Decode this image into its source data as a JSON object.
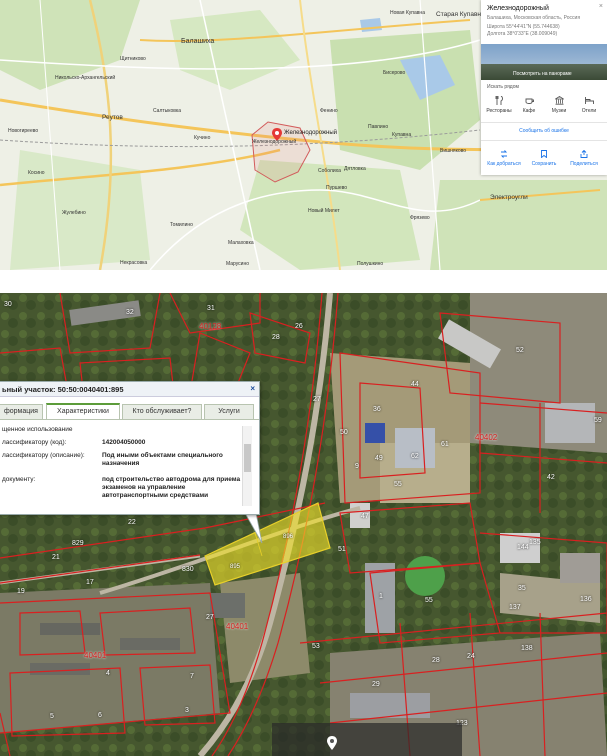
{
  "top_map": {
    "city_labels": [
      {
        "name": "city-balashikha",
        "text": "Балашиха"
      },
      {
        "name": "city-reutov",
        "text": "Реутов"
      },
      {
        "name": "city-zheleznodorozhny-marker",
        "text": "Железнодорожный"
      },
      {
        "name": "city-zheleznodorozhny-sub",
        "text": "Железнодорожный"
      },
      {
        "name": "city-staraya-kupavna",
        "text": "Старая Купавна"
      },
      {
        "name": "city-elektrougli",
        "text": "Электроугли"
      }
    ],
    "small_labels": [
      "Новая Купавна",
      "Щитниково",
      "Никольско-Архангельский",
      "Салтыковка",
      "Кучино",
      "Фенино",
      "Пуршево",
      "Соболиха",
      "Дятловка",
      "Новый Милет",
      "Малаховка",
      "Томилино",
      "Жулебино",
      "Некрасовка",
      "Косино",
      "Новогиреево",
      "Бисерово",
      "Павлино",
      "Купавна",
      "Фрязево",
      "Марусино",
      "Полушкино",
      "Вишняково"
    ],
    "info_panel": {
      "title": "Железнодорожный",
      "subtitle": "Балашиха, Московская область, Россия",
      "latitude_line": "Широта    55°44'41\"N (55.744638)",
      "longitude_line": "Долгота   38°0'33\"E (38.009049)",
      "photo_caption": "Посмотреть на панораме",
      "nearby_title": "Искать рядом",
      "nearby_items": [
        "Рестораны",
        "Кафе",
        "Музеи",
        "Отели"
      ],
      "report_link": "Сообщить об ошибке",
      "actions": [
        "Как добраться",
        "Сохранить",
        "Поделиться"
      ],
      "close_label": "×"
    }
  },
  "parcel_popup": {
    "title": "ьный участок: 50:50:0040401:895",
    "close_label": "×",
    "tabs": [
      "формация",
      "Характеристики",
      "Кто обслуживает?",
      "Услуги"
    ],
    "active_tab": "Характеристики",
    "rows": [
      {
        "key": "щенное использование",
        "value": ""
      },
      {
        "key": "лассификатору (код):",
        "value": "142004050000"
      },
      {
        "key": "лассификатору (описание):",
        "value": "Под иными объектами специального назначения"
      },
      {
        "key": "документу:",
        "value": "под строительство автодрома для приема экзаменов на управление автотранспортными средствами"
      }
    ]
  },
  "parcel_labels": [
    {
      "name": "label-896",
      "text": "896"
    },
    {
      "name": "label-895",
      "text": "895"
    },
    {
      "name": "label-40401-a",
      "text": "40401"
    },
    {
      "name": "label-40401-b",
      "text": "40401"
    },
    {
      "name": "label-40402",
      "text": "40402"
    },
    {
      "name": "label-40128",
      "text": "40128"
    },
    {
      "name": "label-830",
      "text": "830"
    },
    {
      "name": "label-829",
      "text": "829"
    }
  ],
  "lot_numbers": [
    "30",
    "32",
    "31",
    "26",
    "28",
    "27",
    "44",
    "36",
    "50",
    "49",
    "62",
    "61",
    "55",
    "52",
    "59",
    "42",
    "135",
    "144",
    "136",
    "137",
    "138",
    "1",
    "55",
    "17",
    "19",
    "22",
    "21",
    "27",
    "51",
    "47",
    "28",
    "29",
    "24",
    "4",
    "6",
    "3",
    "7",
    "5",
    "123",
    "35",
    "53",
    "9"
  ],
  "colors": {
    "boundary": "#d92020",
    "highlight_fill": "#f1e02a",
    "link": "#1a73e8",
    "active_tab_border": "#5c9c3a"
  }
}
